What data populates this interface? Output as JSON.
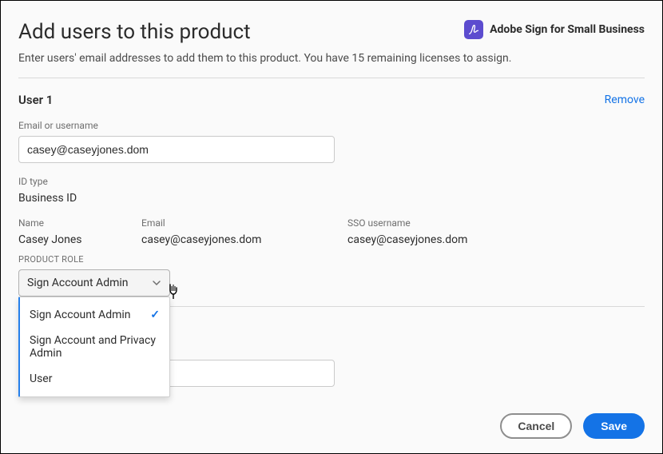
{
  "header": {
    "title": "Add users to this product",
    "product_name": "Adobe Sign for Small Business",
    "subtitle": "Enter users' email addresses to add them to this product. You have 15 remaining licenses to assign."
  },
  "user1": {
    "heading": "User 1",
    "remove": "Remove",
    "email_label": "Email or username",
    "email_value": "casey@caseyjones.dom",
    "id_type_label": "ID type",
    "id_type_value": "Business ID",
    "name_label": "Name",
    "name_value": "Casey Jones",
    "email_col_label": "Email",
    "email_col_value": "casey@caseyjones.dom",
    "sso_label": "SSO username",
    "sso_value": "casey@caseyjones.dom",
    "role_label": "PRODUCT ROLE",
    "role_selected": "Sign Account Admin",
    "role_options": {
      "opt1": "Sign Account Admin",
      "opt2": "Sign Account and Privacy Admin",
      "opt3": "User"
    }
  },
  "footer": {
    "cancel": "Cancel",
    "save": "Save"
  }
}
